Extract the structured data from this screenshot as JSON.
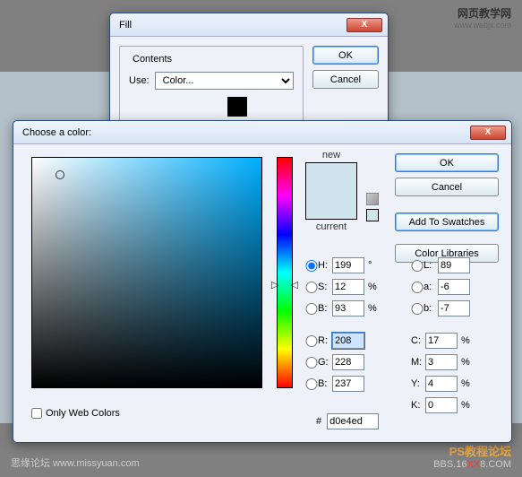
{
  "watermarks": {
    "tr_title": "网页教学网",
    "tr_url": "www.webjx.com",
    "bl": "思缘论坛  www.missyuan.com",
    "br_top": "PS教程论坛",
    "br_bottom_pre": "BBS.16",
    "br_bottom_mid": "XX",
    "br_bottom_post": "8.COM"
  },
  "fill": {
    "title": "Fill",
    "contents_legend": "Contents",
    "use_label": "Use:",
    "use_value": "Color...",
    "ok": "OK",
    "cancel": "Cancel"
  },
  "picker": {
    "title": "Choose a color:",
    "new_label": "new",
    "current_label": "current",
    "ok": "OK",
    "cancel": "Cancel",
    "add_swatches": "Add To Swatches",
    "color_libraries": "Color Libraries",
    "only_web": "Only Web Colors",
    "hex_prefix": "#",
    "hex": "d0e4ed",
    "H_label": "H:",
    "H": "199",
    "H_unit": "°",
    "S_label": "S:",
    "S": "12",
    "S_unit": "%",
    "Bv_label": "B:",
    "Bv": "93",
    "Bv_unit": "%",
    "L_label": "L:",
    "L": "89",
    "a_label": "a:",
    "a": "-6",
    "b_label": "b:",
    "b": "-7",
    "R_label": "R:",
    "R": "208",
    "G_label": "G:",
    "G": "228",
    "Bb_label": "B:",
    "Bb": "237",
    "C_label": "C:",
    "C": "17",
    "C_unit": "%",
    "M_label": "M:",
    "M": "3",
    "M_unit": "%",
    "Y_label": "Y:",
    "Y": "4",
    "Y_unit": "%",
    "K_label": "K:",
    "K": "0",
    "K_unit": "%"
  }
}
